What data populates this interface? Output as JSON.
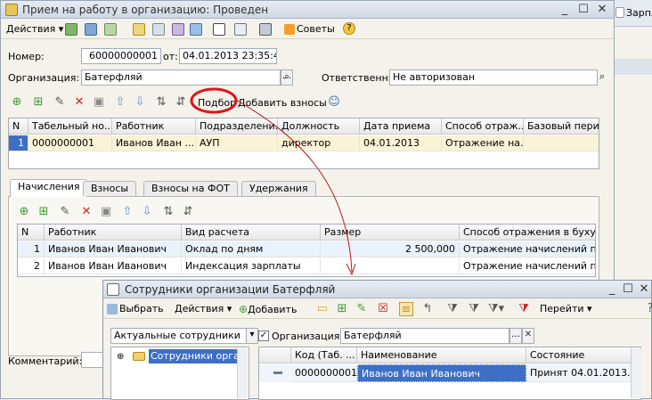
{
  "main_window": {
    "title": "Прием на работу в организацию: Проведен",
    "toolbar": {
      "actions_label": "Действия",
      "tips_label": "Советы"
    },
    "number_label": "Номер:",
    "number_value": "60000000001",
    "date_label": "от:",
    "date_value": "04.01.2013 23:35:42",
    "org_label": "Организация:",
    "org_value": "Батерфляй",
    "responsible_label": "Ответственный:",
    "responsible_value": "Не авторизован",
    "select_button": "Подбор",
    "add_contrib_button": "Добавить взносы",
    "table": {
      "headers": [
        "N",
        "Табельный но...",
        "Работник",
        "Подразделени...",
        "Должность",
        "Дата приема",
        "Способ отраж...",
        "Базовый пери..."
      ],
      "rows": [
        [
          "1",
          "0000000001",
          "Иванов Иван ...",
          "АУП",
          "директор",
          "04.01.2013",
          "Отражение на...",
          ""
        ]
      ]
    },
    "tabs": [
      "Начисления",
      "Взносы",
      "Взносы на ФОТ",
      "Удержания"
    ],
    "accruals_table": {
      "headers": [
        "N",
        "Работник",
        "Вид расчета",
        "Размер",
        "Способ отражения в бухуч..."
      ],
      "rows": [
        [
          "1",
          "Иванов Иван Иванович",
          "Оклад по дням",
          "2 500,000",
          "Отражение начислений по ..."
        ],
        [
          "2",
          "Иванов Иван Иванович",
          "Индексация зарплаты",
          "",
          "Отражение начислений по ..."
        ]
      ]
    },
    "comment_label": "Комментарий:"
  },
  "background_window": {
    "partial_title": "Зарпл"
  },
  "dialog": {
    "title": "Сотрудники организации Батерфляй",
    "toolbar": {
      "select": "Выбрать",
      "actions": "Действия",
      "add": "Добавить",
      "goto": "Перейти"
    },
    "filter_value": "Актуальные сотрудники",
    "org_checkbox_label": "Организация:",
    "org_value": "Батерфляй",
    "tree_item": "Сотрудники органи",
    "list": {
      "headers": [
        "Код (Таб. ...",
        "Наименование",
        "Состояние"
      ],
      "rows": [
        [
          "0000000001",
          "Иванов Иван Иванович",
          "Принят 04.01.2013. ..."
        ]
      ]
    }
  },
  "colors": {
    "highlight_circle": "#e0141a",
    "arrow": "#c0141a",
    "row_highlight": "#b9d3f0",
    "selected_cell": "#3d6fc4"
  }
}
